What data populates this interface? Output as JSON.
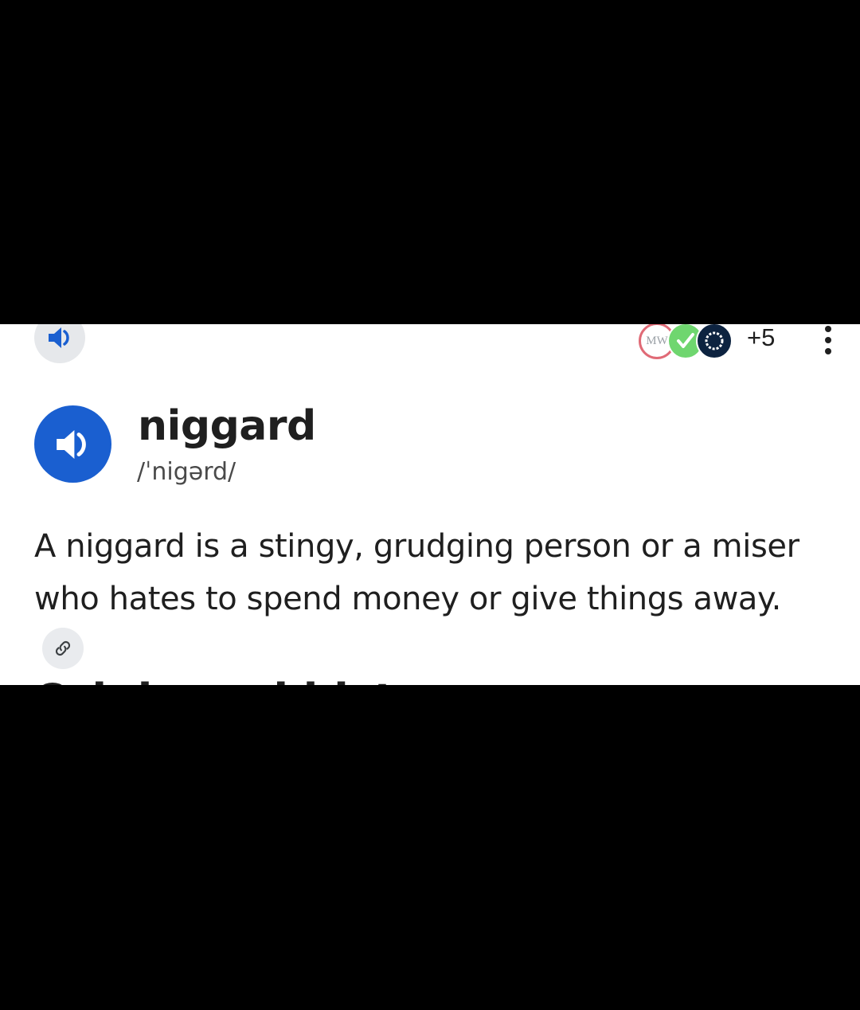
{
  "header": {
    "sources": [
      "MW",
      "check",
      "ring"
    ],
    "more_sources": "+5"
  },
  "entry": {
    "word": "niggard",
    "pronunciation": "/ˈnigərd/",
    "definition": "A niggard is a stingy, grudging person or a miser who hates to spend money or give things away.",
    "next_section": "Origin and history"
  },
  "icons": {
    "top_speaker": "speaker-icon",
    "main_speaker": "speaker-icon",
    "link": "link-icon",
    "more": "more-vertical-icon"
  },
  "colors": {
    "accent": "#1a5fd0",
    "mw_ring": "#e06a76",
    "check_green": "#6fd66f",
    "ring_navy": "#0d2340"
  }
}
